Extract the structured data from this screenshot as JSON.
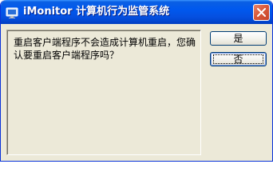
{
  "window": {
    "title": "iMonitor 计算机行为监管系统",
    "icon": "imonitor-app-icon",
    "close_icon": "close-icon"
  },
  "dialog": {
    "message": "重启客户端程序不会造成计算机重启，您确认要重启客户端程序吗？",
    "yes_label": "是",
    "no_label": "否"
  },
  "colors": {
    "titlebar": "#0058ee",
    "close_button": "#d85a3a",
    "window_bg": "#ece9d8",
    "button_border": "#003c74"
  }
}
